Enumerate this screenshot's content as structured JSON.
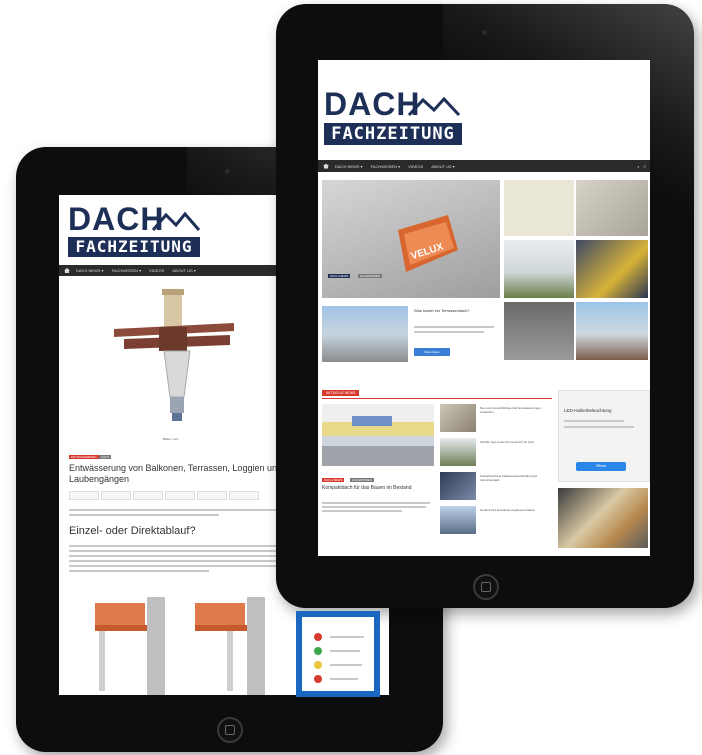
{
  "logo": {
    "word1": "DACH",
    "word2": "FACHZEITUNG"
  },
  "nav": {
    "items": [
      "DACH NEWS ▾",
      "FACHWISSEN ▾",
      "VIDEOS",
      "ABOUT US ▾"
    ]
  },
  "back_tablet": {
    "image_caption": "Bilder: Loro",
    "tags": [
      "ENTWÄSSERUNG",
      "HAUS"
    ],
    "headline": "Entwässerung von Balkonen, Terrassen, Loggien und Laubengängen",
    "share_buttons": [
      "Teilen",
      "Twittern",
      "Teilen",
      "Pin",
      "Mail",
      "Share"
    ],
    "section_title": "Einzel- oder Direktablauf?"
  },
  "front_tablet": {
    "hero_tags": [
      "DACH NEWS",
      "FACHWISSEN"
    ],
    "ad_title": "Was kostet ein Terrassendach?",
    "ad_button": "Weiterlesen",
    "section_label": "AKTUELLE NEWS",
    "feature_tags": [
      "DACH NEWS",
      "FACHWISSEN"
    ],
    "feature_title": "Kompaktdach für das Bauen im Bestand",
    "list_items": [
      "Neu und zukunftsfähige Dachentwässerungen entdecken",
      "Schiffer legt neues Firmenarchiv für Holz",
      "Kesselsteinfreie Kaltwasserbehandlung bei Industrieobjekt",
      "Neuheit fürs Entwässerungsbauvorhaben"
    ],
    "side_ad_title": "LED-Hallenbeleuchtung",
    "side_ad_button": "Öffnen"
  },
  "colors": {
    "brand": "#1d2f57",
    "accent": "#d73a2f",
    "nav": "#2a2a2a"
  }
}
